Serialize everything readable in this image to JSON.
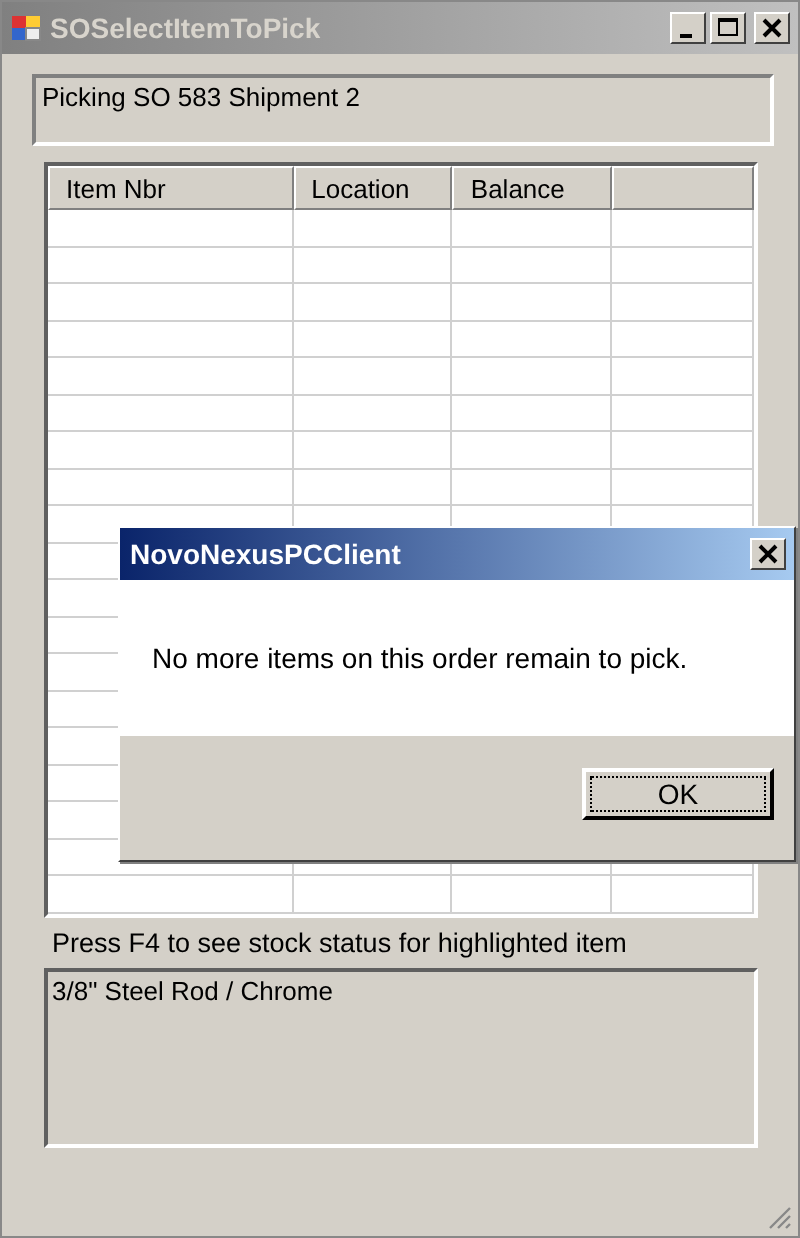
{
  "window": {
    "title": "SOSelectItemToPick"
  },
  "header": {
    "text": "Picking SO 583 Shipment 2"
  },
  "grid": {
    "columns": [
      "Item Nbr",
      "Location",
      "Balance"
    ]
  },
  "hint": "Press F4 to see stock status for highlighted item",
  "description": {
    "value": "3/8\" Steel Rod / Chrome"
  },
  "dialog": {
    "title": "NovoNexusPCClient",
    "message": "No more items on this order remain to pick.",
    "buttons": [
      "OK"
    ]
  }
}
